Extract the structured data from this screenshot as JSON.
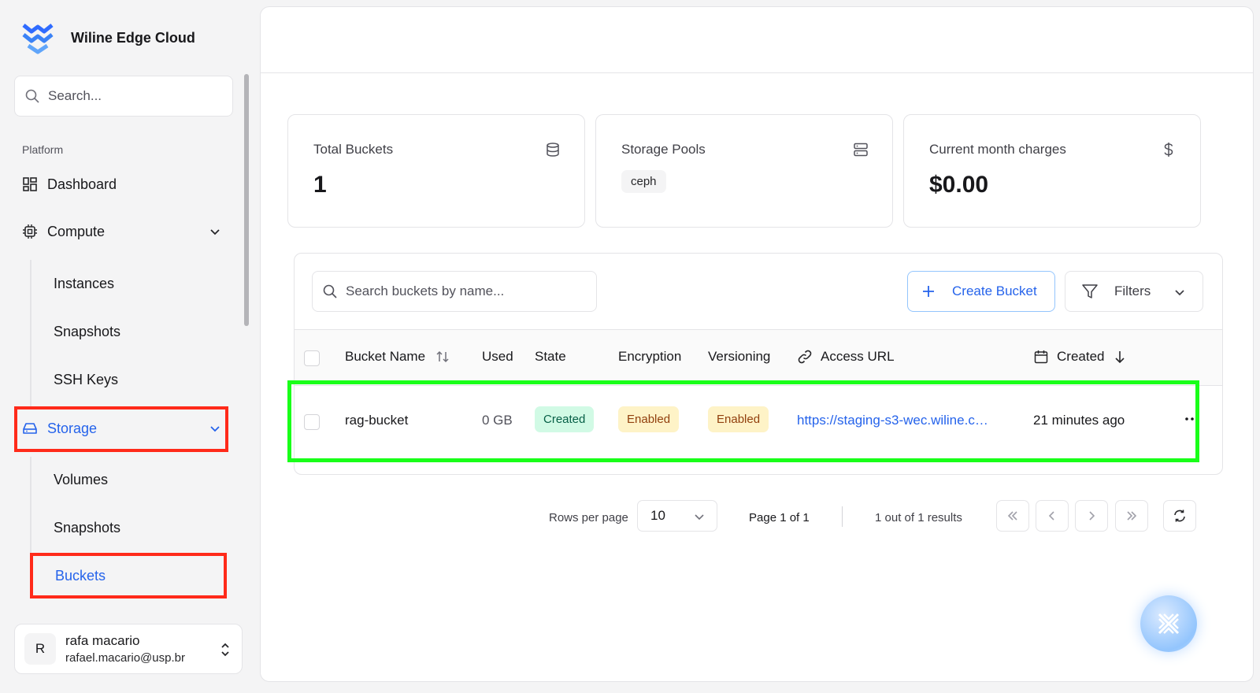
{
  "brand": {
    "name": "Wiline Edge Cloud"
  },
  "sidebar": {
    "search_placeholder": "Search...",
    "section_label": "Platform",
    "dashboard": "Dashboard",
    "compute": {
      "label": "Compute",
      "children": [
        "Instances",
        "Snapshots",
        "SSH Keys"
      ]
    },
    "storage": {
      "label": "Storage",
      "children": [
        "Volumes",
        "Snapshots",
        "Buckets"
      ],
      "active_child": "Buckets"
    }
  },
  "user": {
    "initial": "R",
    "name": "rafa macario",
    "email": "rafael.macario@usp.br"
  },
  "stats": {
    "total_buckets": {
      "title": "Total Buckets",
      "value": "1"
    },
    "storage_pools": {
      "title": "Storage Pools",
      "chip": "ceph"
    },
    "charges": {
      "title": "Current month charges",
      "value": "$0.00"
    }
  },
  "table": {
    "search_placeholder": "Search buckets by name...",
    "create_label": "Create Bucket",
    "filters_label": "Filters",
    "columns": [
      "Bucket Name",
      "Used",
      "State",
      "Encryption",
      "Versioning",
      "Access URL",
      "Created"
    ],
    "rows": [
      {
        "name": "rag-bucket",
        "used": "0 GB",
        "state": "Created",
        "encryption": "Enabled",
        "versioning": "Enabled",
        "url": "https://staging-s3-wec.wiline.c…",
        "created": "21 minutes ago"
      }
    ]
  },
  "pagination": {
    "rows_per_page_label": "Rows per page",
    "rows_per_page": "10",
    "page_text": "Page 1 of 1",
    "results_text": "1 out of 1 results"
  },
  "colors": {
    "accent": "#2563eb",
    "highlight_red": "#ff2a1a",
    "highlight_green": "#19ff19"
  }
}
